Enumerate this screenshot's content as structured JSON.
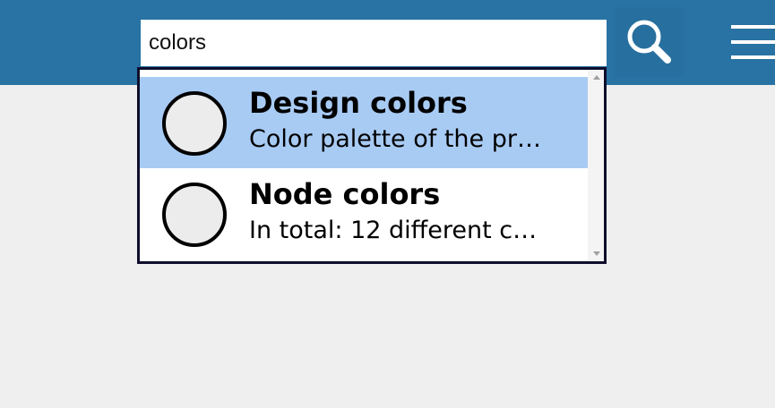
{
  "search": {
    "query": "colors"
  },
  "header": {
    "search_icon": "magnifier-icon",
    "menu_icon": "hamburger-menu-icon"
  },
  "results": [
    {
      "title": "Design colors",
      "description": "Color palette of the pr…",
      "selected": true
    },
    {
      "title": "Node colors",
      "description": "In total: 12 different c…",
      "selected": false
    }
  ],
  "colors": {
    "header_bg": "#2873a3",
    "selected_bg": "#a8cbf4",
    "page_bg": "#efefef"
  }
}
